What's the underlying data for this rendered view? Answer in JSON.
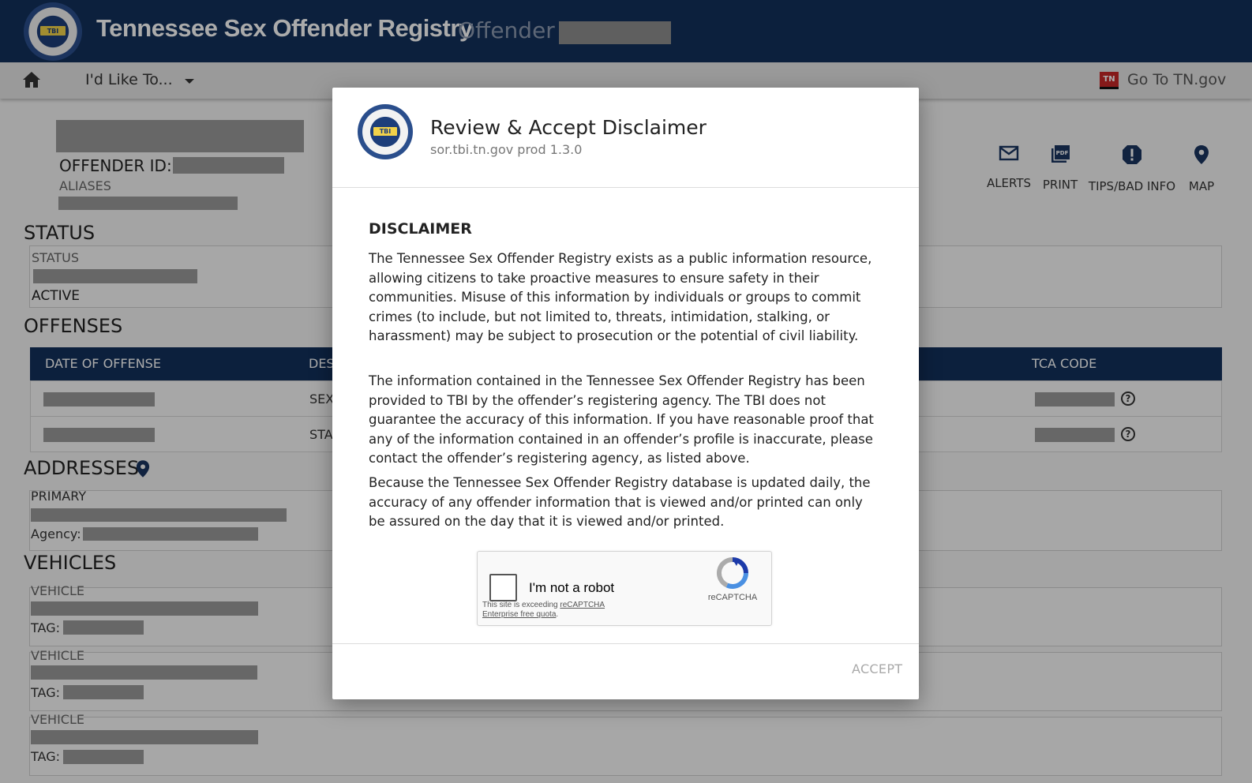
{
  "header": {
    "title": "Tennessee Sex Offender Registry",
    "subtitle": "Offender",
    "seal_text": "TBI"
  },
  "nav": {
    "menu_label": "I'd Like To...",
    "tn_badge": "TN",
    "tn_link": "Go To TN.gov"
  },
  "profile": {
    "offender_id_label": "OFFENDER ID:",
    "aliases_label": "ALIASES"
  },
  "actions": [
    {
      "label": "ALERTS",
      "icon": "mail-icon"
    },
    {
      "label": "PRINT",
      "icon": "pdf-icon"
    },
    {
      "label": "TIPS/BAD INFO",
      "icon": "alert-icon"
    },
    {
      "label": "MAP",
      "icon": "map-pin-icon"
    }
  ],
  "status": {
    "heading": "STATUS",
    "label": "STATUS",
    "value": "ACTIVE"
  },
  "offenses": {
    "heading": "OFFENSES",
    "columns": [
      "DATE OF OFFENSE",
      "DES",
      "TCA CODE"
    ],
    "rows": [
      {
        "desc": "SEX"
      },
      {
        "desc": "STA"
      }
    ]
  },
  "addresses": {
    "heading": "ADDRESSES",
    "primary_label": "PRIMARY",
    "agency_label": "Agency:"
  },
  "vehicles": {
    "heading": "VEHICLES",
    "items": [
      {
        "label": "VEHICLE",
        "tag_label": "TAG:"
      },
      {
        "label": "VEHICLE",
        "tag_label": "TAG:"
      },
      {
        "label": "VEHICLE",
        "tag_label": "TAG:"
      }
    ]
  },
  "modal": {
    "title": "Review & Accept Disclaimer",
    "subtitle": "sor.tbi.tn.gov prod 1.3.0",
    "heading": "DISCLAIMER",
    "paragraphs": [
      "The Tennessee Sex Offender Registry exists as a public information resource, allowing citizens to take proactive measures to ensure safety in their communities. Misuse of this information by individuals or groups to commit crimes (to include, but not limited to, threats, intimidation, stalking, or harassment) may be subject to prosecution or the potential of civil liability.",
      "The information contained in the Tennessee Sex Offender Registry has been provided to TBI by the offender’s registering agency. The TBI does not guarantee the accuracy of this information. If you have reasonable proof that any of the information contained in an offender’s profile is inaccurate, please contact the offender’s registering agency, as listed above.",
      "Because the Tennessee Sex Offender Registry database is updated daily, the accuracy of any offender information that is viewed and/or printed can only be assured on the day that it is viewed and/or printed."
    ],
    "captcha": {
      "label": "I'm not a robot",
      "brand": "reCAPTCHA",
      "note_prefix": "This site is exceeding ",
      "note_link": "reCAPTCHA Enterprise free quota",
      "note_suffix": "."
    },
    "accept_label": "ACCEPT"
  },
  "colors": {
    "header_bg": "#13315c",
    "table_header_bg": "#13315c",
    "tn_red": "#c62828"
  }
}
